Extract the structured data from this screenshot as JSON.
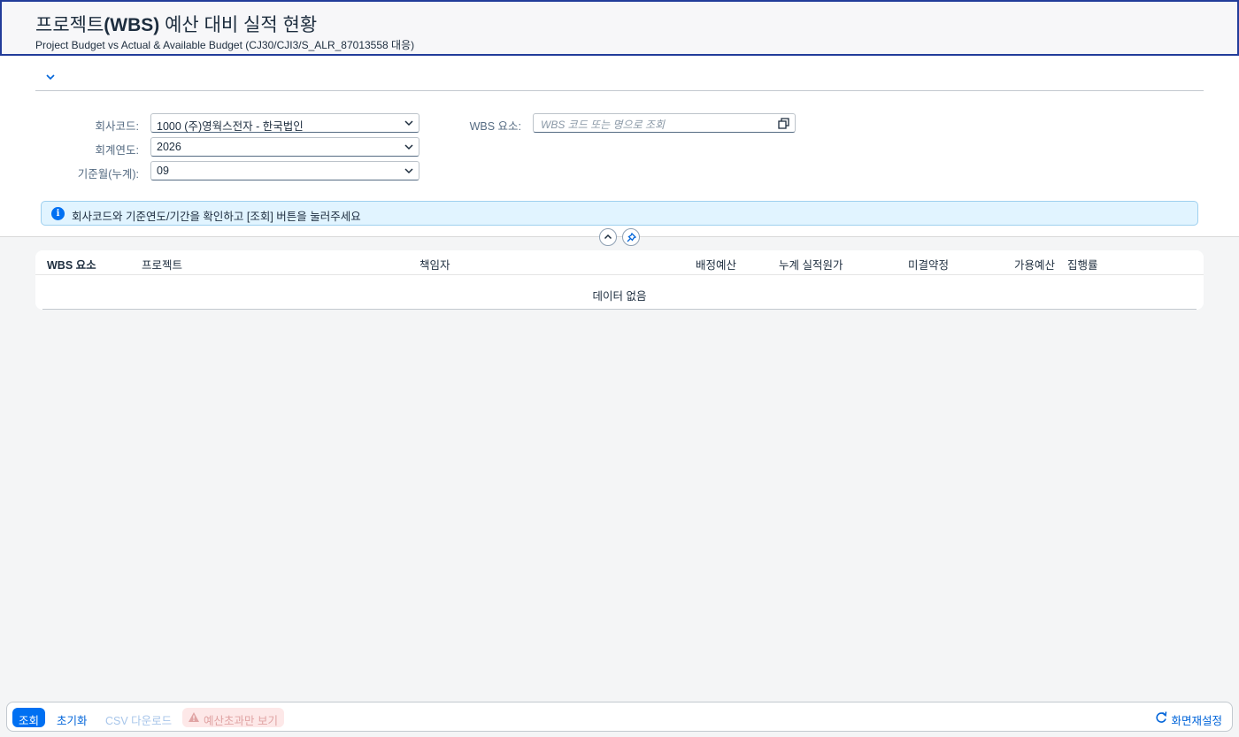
{
  "header": {
    "title_prefix": "프로젝트",
    "title_bold": "(WBS)",
    "title_suffix": " 예산 대비 실적 현황",
    "subtitle": "Project Budget vs Actual & Available Budget (CJ30/CJI3/S_ALR_87013558 대응)"
  },
  "filters": {
    "company_label": "회사코드:",
    "company_value": "1000 (주)영웍스전자 - 한국법인",
    "year_label": "회계연도:",
    "year_value": "2026",
    "month_label": "기준월(누계):",
    "month_value": "09",
    "wbs_label": "WBS 요소:",
    "wbs_placeholder": "WBS 코드 또는 명으로 조회"
  },
  "info_message": "회사코드와 기준연도/기간을 확인하고 [조회] 버튼을 눌러주세요",
  "table": {
    "columns": [
      "WBS 요소",
      "프로젝트",
      "책임자",
      "배정예산",
      "누계 실적원가",
      "미결약정",
      "가용예산",
      "집행률"
    ],
    "empty_text": "데이터 없음"
  },
  "footer": {
    "search_label": "조회",
    "reset_label": "초기화",
    "csv_label": "CSV 다운로드",
    "over_budget_label": "예산초과만 보기",
    "screen_reset_label": "화면재설정"
  },
  "colors": {
    "accent": "#0070f2",
    "info_bg": "#e1f4ff",
    "header_border": "#223c9a",
    "warn_bg": "#fde8e8"
  },
  "icons": {
    "expand": "chevron-down-icon",
    "value_help": "value-help-icon",
    "info": "info-icon",
    "collapse": "chevron-up-icon",
    "pin": "pin-icon",
    "warning": "warning-icon",
    "refresh": "refresh-icon"
  }
}
